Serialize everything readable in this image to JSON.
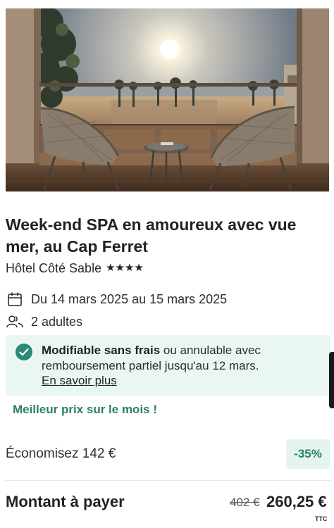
{
  "offer": {
    "title": "Week-end SPA en amoureux avec vue mer, au Cap Ferret",
    "hotel_name": "Hôtel Côté Sable",
    "stars_text": "★★★★",
    "star_rating": 4,
    "dates": "Du 14 mars 2025 au 15 mars 2025",
    "guests": "2 adultes"
  },
  "cancellation": {
    "bold": "Modifiable sans frais",
    "text": " ou annulable avec remboursement partiel jusqu'au 12 mars.",
    "link": "En savoir plus"
  },
  "promo": {
    "best_price": "Meilleur prix sur le mois !"
  },
  "pricing": {
    "savings": "Économisez 142 €",
    "discount": "-35%",
    "total_label": "Montant à payer",
    "old_price": "402 €",
    "new_price": "260,25 €",
    "tax_note": "TTC"
  },
  "icons": {
    "dates": "calendar-icon",
    "guests": "people-icon",
    "cancellation": "check-circle-icon"
  },
  "colors": {
    "accent": "#2a7f6a",
    "info_bg": "#eaf6f2",
    "badge_bg": "#e6f4ef"
  }
}
